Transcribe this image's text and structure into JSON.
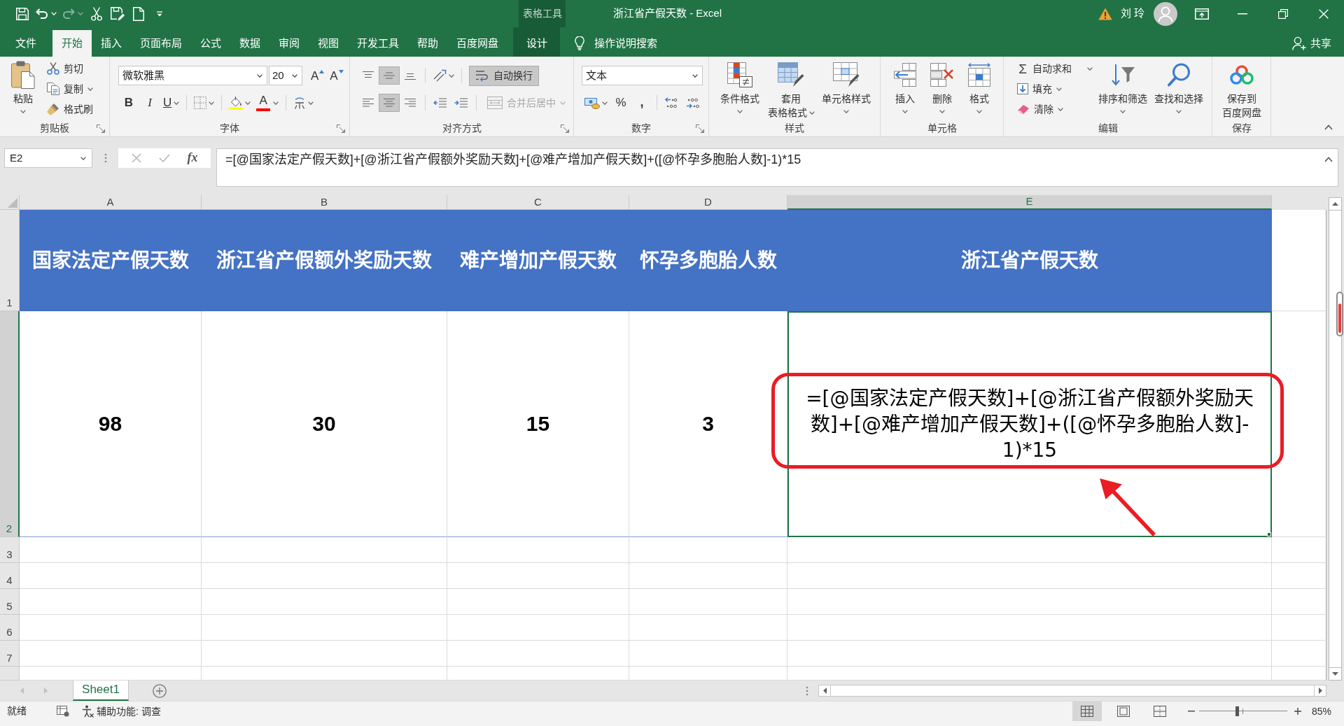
{
  "window": {
    "title": "浙江省产假天数 - Excel",
    "context_group": "表格工具",
    "user": "刘 玲"
  },
  "quick_access": [
    {
      "disabled": false
    },
    {
      "disabled": false
    },
    {
      "disabled": true
    },
    {
      "disabled": false
    },
    {
      "disabled": false
    },
    {
      "disabled": false
    },
    {
      "disabled": false
    }
  ],
  "ribbon_tabs": [
    {
      "label": "文件",
      "selected": false,
      "kind": "normal"
    },
    {
      "label": "开始",
      "selected": true,
      "kind": "normal"
    },
    {
      "label": "插入",
      "selected": false,
      "kind": "normal"
    },
    {
      "label": "页面布局",
      "selected": false,
      "kind": "normal"
    },
    {
      "label": "公式",
      "selected": false,
      "kind": "normal"
    },
    {
      "label": "数据",
      "selected": false,
      "kind": "normal"
    },
    {
      "label": "审阅",
      "selected": false,
      "kind": "normal"
    },
    {
      "label": "视图",
      "selected": false,
      "kind": "normal"
    },
    {
      "label": "开发工具",
      "selected": false,
      "kind": "normal"
    },
    {
      "label": "帮助",
      "selected": false,
      "kind": "normal"
    },
    {
      "label": "百度网盘",
      "selected": false,
      "kind": "normal"
    },
    {
      "label": "设计",
      "selected": false,
      "kind": "contextual"
    }
  ],
  "tell_me": "操作说明搜索",
  "share": "共享",
  "ribbon_groups": [
    {
      "label": "剪贴板",
      "buttons": [
        {
          "label": "粘贴"
        },
        {
          "label": "剪切"
        },
        {
          "label": "复制"
        },
        {
          "label": "格式刷"
        }
      ]
    },
    {
      "label": "字体",
      "font_name": "微软雅黑",
      "font_size": "20",
      "buttons": [
        {
          "label": "A"
        },
        {
          "label": "A"
        },
        {
          "label": "B"
        },
        {
          "label": "I"
        },
        {
          "label": "U"
        },
        {
          "label": "A"
        }
      ]
    },
    {
      "label": "对齐方式",
      "toggles": [
        {
          "pressed": false
        },
        {
          "pressed": true
        },
        {
          "pressed": false
        },
        {
          "pressed": false
        },
        {
          "pressed": false
        },
        {
          "pressed": true
        },
        {
          "pressed": false
        },
        {
          "pressed": false
        },
        {
          "pressed": false
        }
      ],
      "wrap_text": {
        "label": "自动换行",
        "pressed": true
      },
      "merge": {
        "label": "合并后居中",
        "disabled": true
      }
    },
    {
      "label": "数字",
      "number_format": "文本",
      "buttons": [
        {
          "label": "%"
        },
        {
          "label": ","
        }
      ]
    },
    {
      "label": "样式",
      "buttons": [
        {
          "lines": [
            "条件格式"
          ]
        },
        {
          "lines": [
            "套用",
            "表格格式"
          ]
        },
        {
          "lines": [
            "单元格样式"
          ]
        }
      ]
    },
    {
      "label": "单元格",
      "buttons": [
        {
          "label": "插入"
        },
        {
          "label": "删除"
        },
        {
          "label": "格式"
        }
      ]
    },
    {
      "label": "编辑",
      "buttons": [
        {
          "label": "自动求和",
          "glyph": "Σ"
        },
        {
          "label": "填充"
        },
        {
          "label": "清除"
        },
        {
          "label": "排序和筛选"
        },
        {
          "label": "查找和选择"
        }
      ]
    },
    {
      "label": "保存",
      "buttons": [
        {
          "lines": [
            "保存到",
            "百度网盘"
          ]
        }
      ]
    }
  ],
  "name_box": "E2",
  "formula_bar": {
    "function_button": "fx",
    "value": "=[@国家法定产假天数]+[@浙江省产假额外奖励天数]+[@难产增加产假天数]+([@怀孕多胞胎人数]-1)*15"
  },
  "columns": [
    {
      "label": "A",
      "selected": false
    },
    {
      "label": "B",
      "selected": false
    },
    {
      "label": "C",
      "selected": false
    },
    {
      "label": "D",
      "selected": false
    },
    {
      "label": "E",
      "selected": true
    }
  ],
  "rows": [
    {
      "label": "1",
      "selected": false,
      "kind": "header",
      "cells": [
        {
          "text": "国家法定产假天数",
          "selected": false
        },
        {
          "text": "浙江省产假额外奖励天数",
          "selected": false
        },
        {
          "text": "难产增加产假天数",
          "selected": false
        },
        {
          "text": "怀孕多胞胎人数",
          "selected": false
        },
        {
          "text": "浙江省产假天数",
          "selected": false
        }
      ]
    },
    {
      "label": "2",
      "selected": true,
      "kind": "data",
      "cells": [
        {
          "text": "98",
          "selected": false,
          "kind": "value"
        },
        {
          "text": "30",
          "selected": false,
          "kind": "value"
        },
        {
          "text": "15",
          "selected": false,
          "kind": "value"
        },
        {
          "text": "3",
          "selected": false,
          "kind": "value"
        },
        {
          "text": "=[@国家法定产假天数]+[@浙江省产假额外奖励天数]+[@难产增加产假天数]+([@怀孕多胞胎人数]-1)*15",
          "selected": true,
          "kind": "formula"
        }
      ]
    },
    {
      "label": "3",
      "selected": false,
      "kind": "empty"
    },
    {
      "label": "4",
      "selected": false,
      "kind": "empty"
    },
    {
      "label": "5",
      "selected": false,
      "kind": "empty"
    },
    {
      "label": "6",
      "selected": false,
      "kind": "empty"
    },
    {
      "label": "7",
      "selected": false,
      "kind": "empty"
    }
  ],
  "annotations": [
    {
      "kind": "frame"
    },
    {
      "kind": "arrow"
    }
  ],
  "sheet_tabs": [
    {
      "label": "Sheet1",
      "selected": true
    }
  ],
  "status_bar": {
    "status": "就绪",
    "accessibility": "辅助功能: 调查",
    "views": [
      {
        "selected": true
      },
      {
        "selected": false
      },
      {
        "selected": false
      }
    ],
    "zoom": {
      "level": 0.43,
      "reading": "85%"
    }
  }
}
